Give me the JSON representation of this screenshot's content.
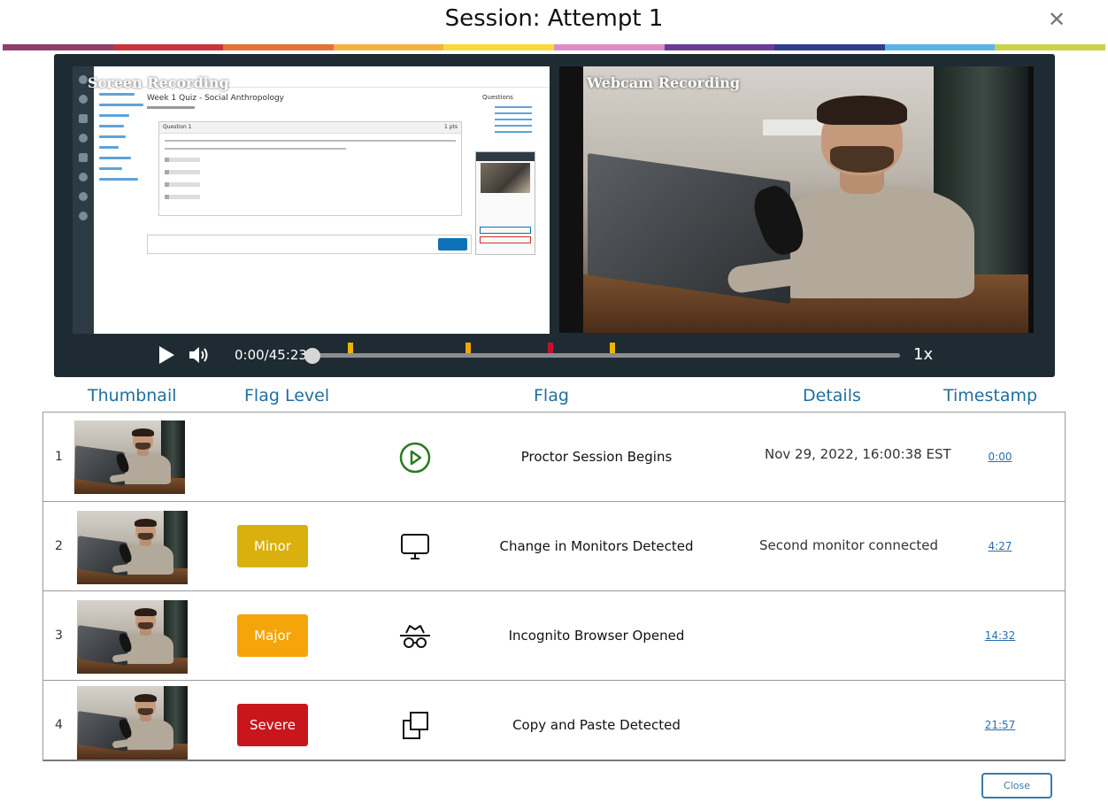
{
  "modal": {
    "title": "Session: Attempt 1",
    "close_glyph": "✕",
    "close_icon": "close-icon"
  },
  "color_strip": [
    "#8e3f6a",
    "#c8343b",
    "#e5703a",
    "#f1b43c",
    "#f4db3b",
    "#dc8ec7",
    "#6a3b95",
    "#2f3f8c",
    "#5cb3e3",
    "#c8d34a"
  ],
  "player": {
    "screen_label": "Screen Recording",
    "webcam_label": "Webcam Recording",
    "screen_content": {
      "quiz_title": "Week 1 Quiz - Social Anthropology",
      "question_header": "Question 1",
      "question_points": "1 pts",
      "questions_heading": "Questions"
    },
    "current_time": "0:00",
    "total_time": "45:23",
    "time_display": "0:00/45:23",
    "speed": "1x",
    "play_icon": "play-icon",
    "volume_icon": "volume-icon",
    "progress": 0,
    "flag_markers": [
      {
        "position_fraction": 0.065,
        "color": "#f0b400",
        "level": "minor"
      },
      {
        "position_fraction": 0.265,
        "color": "#f0a500",
        "level": "major"
      },
      {
        "position_fraction": 0.405,
        "color": "#c8102e",
        "level": "severe"
      },
      {
        "position_fraction": 0.51,
        "color": "#f0b400",
        "level": "minor"
      }
    ]
  },
  "table": {
    "headers": {
      "thumbnail": "Thumbnail",
      "flag_level": "Flag Level",
      "flag": "Flag",
      "details": "Details",
      "timestamp": "Timestamp"
    },
    "rows": [
      {
        "num": "1",
        "level": "",
        "level_color": "",
        "icon": "play-circle-icon",
        "flag": "Proctor Session Begins",
        "details": "Nov 29, 2022, 16:00:38 EST",
        "timestamp": "0:00"
      },
      {
        "num": "2",
        "level": "Minor",
        "level_color": "#d9b00e",
        "icon": "monitor-icon",
        "flag": "Change in Monitors Detected",
        "details": "Second monitor connected",
        "timestamp": "4:27"
      },
      {
        "num": "3",
        "level": "Major",
        "level_color": "#f5a50a",
        "icon": "incognito-icon",
        "flag": "Incognito Browser Opened",
        "details": "",
        "timestamp": "14:32"
      },
      {
        "num": "4",
        "level": "Severe",
        "level_color": "#c8161c",
        "icon": "copy-icon",
        "flag": "Copy and Paste Detected",
        "details": "",
        "timestamp": "21:57"
      }
    ]
  },
  "footer": {
    "close_label": "Close"
  }
}
